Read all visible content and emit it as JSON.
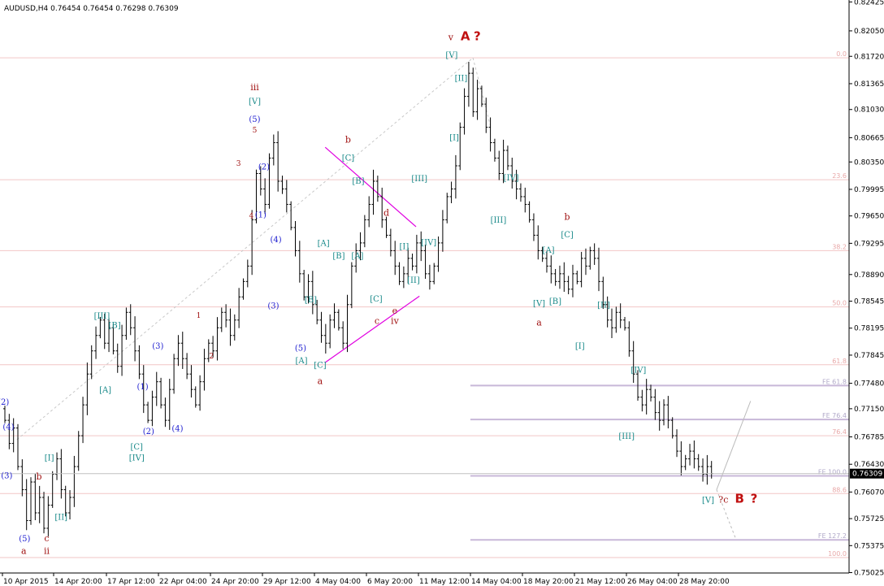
{
  "header": {
    "symbol_line": "AUDUSD,H4  0.76454 0.76454 0.76298 0.76309"
  },
  "colors": {
    "candle": "#000000",
    "fib_line": "#f2c6c6",
    "fe_line": "#c8b8d8",
    "channel": "#e000e0",
    "current_price_bg": "#000000",
    "current_price_text": "#ffffff"
  },
  "chart_data": {
    "type": "bar",
    "symbol": "AUDUSD",
    "timeframe": "H4",
    "ohlc_header": {
      "open": 0.76454,
      "high": 0.76454,
      "low": 0.76298,
      "close": 0.76309
    },
    "current_price": "0.76309",
    "ylim": [
      0.7502,
      0.8245
    ],
    "y_ticks": [
      "0.82425",
      "0.82050",
      "0.81720",
      "0.81365",
      "0.81030",
      "0.80665",
      "0.80350",
      "0.79995",
      "0.79650",
      "0.79295",
      "0.78890",
      "0.78545",
      "0.78195",
      "0.77845",
      "0.77480",
      "0.77150",
      "0.76785",
      "0.76430",
      "0.76070",
      "0.75725",
      "0.75375",
      "0.75025"
    ],
    "x_ticks": [
      "10 Apr 2015",
      "14 Apr 20:00",
      "17 Apr 12:00",
      "22 Apr 04:00",
      "24 Apr 20:00",
      "29 Apr 12:00",
      "4 May 04:00",
      "6 May 20:00",
      "11 May 12:00",
      "14 May 04:00",
      "18 May 20:00",
      "21 May 12:00",
      "26 May 04:00",
      "28 May 20:00"
    ],
    "closes": [
      0.77,
      0.767,
      0.769,
      0.764,
      0.761,
      0.757,
      0.762,
      0.758,
      0.76,
      0.756,
      0.759,
      0.763,
      0.765,
      0.761,
      0.758,
      0.76,
      0.764,
      0.768,
      0.772,
      0.776,
      0.779,
      0.781,
      0.783,
      0.78,
      0.782,
      0.779,
      0.777,
      0.781,
      0.784,
      0.782,
      0.779,
      0.776,
      0.772,
      0.77,
      0.773,
      0.775,
      0.772,
      0.77,
      0.774,
      0.778,
      0.78,
      0.778,
      0.776,
      0.774,
      0.772,
      0.775,
      0.778,
      0.78,
      0.779,
      0.782,
      0.784,
      0.783,
      0.781,
      0.783,
      0.786,
      0.788,
      0.79,
      0.796,
      0.802,
      0.8,
      0.798,
      0.804,
      0.806,
      0.801,
      0.8,
      0.798,
      0.795,
      0.792,
      0.789,
      0.786,
      0.788,
      0.785,
      0.783,
      0.781,
      0.78,
      0.783,
      0.784,
      0.782,
      0.78,
      0.785,
      0.79,
      0.792,
      0.793,
      0.796,
      0.798,
      0.801,
      0.799,
      0.796,
      0.794,
      0.792,
      0.79,
      0.788,
      0.789,
      0.791,
      0.79,
      0.793,
      0.792,
      0.789,
      0.788,
      0.79,
      0.793,
      0.796,
      0.799,
      0.8,
      0.803,
      0.808,
      0.812,
      0.815,
      0.81,
      0.813,
      0.811,
      0.808,
      0.806,
      0.804,
      0.802,
      0.805,
      0.803,
      0.801,
      0.8,
      0.799,
      0.798,
      0.796,
      0.794,
      0.792,
      0.791,
      0.79,
      0.789,
      0.788,
      0.789,
      0.788,
      0.787,
      0.789,
      0.788,
      0.791,
      0.79,
      0.792,
      0.791,
      0.788,
      0.785,
      0.783,
      0.782,
      0.784,
      0.783,
      0.782,
      0.779,
      0.776,
      0.773,
      0.772,
      0.774,
      0.773,
      0.771,
      0.77,
      0.772,
      0.77,
      0.768,
      0.766,
      0.764,
      0.765,
      0.766,
      0.765,
      0.764,
      0.763,
      0.764,
      0.7631
    ],
    "fib_levels": [
      {
        "label": "0.0",
        "price": 0.817
      },
      {
        "label": "23.6",
        "price": 0.8012
      },
      {
        "label": "38.2",
        "price": 0.792
      },
      {
        "label": "50.0",
        "price": 0.7847
      },
      {
        "label": "61.8",
        "price": 0.7772
      },
      {
        "label": "76.4",
        "price": 0.768
      },
      {
        "label": "88.6",
        "price": 0.7605
      },
      {
        "label": "100.0",
        "price": 0.7522
      }
    ],
    "fe_levels": [
      {
        "label": "FE 61.8",
        "price": 0.7745
      },
      {
        "label": "FE 76.4",
        "price": 0.7701
      },
      {
        "label": "FE 100.0",
        "price": 0.7628
      },
      {
        "label": "FE 127.2",
        "price": 0.7545
      }
    ],
    "wave_labels": [
      {
        "text": "(2)",
        "style": "blue",
        "x": 0.004,
        "price": 0.772
      },
      {
        "text": "(4)",
        "style": "blue",
        "x": 0.01,
        "price": 0.7688
      },
      {
        "text": "(3)",
        "style": "blue",
        "x": 0.008,
        "price": 0.7625
      },
      {
        "text": "[I]",
        "style": "teal",
        "x": 0.058,
        "price": 0.7648
      },
      {
        "text": "[II]",
        "style": "teal",
        "x": 0.072,
        "price": 0.7571
      },
      {
        "text": "(5)",
        "style": "blue",
        "x": 0.029,
        "price": 0.7543
      },
      {
        "text": "b",
        "style": "red",
        "x": 0.046,
        "price": 0.7623
      },
      {
        "text": "c",
        "style": "red",
        "x": 0.055,
        "price": 0.7543
      },
      {
        "text": "a",
        "style": "red",
        "x": 0.028,
        "price": 0.7527
      },
      {
        "text": "ii",
        "style": "red",
        "x": 0.055,
        "price": 0.7527
      },
      {
        "text": "[III]",
        "style": "teal",
        "x": 0.12,
        "price": 0.7832
      },
      {
        "text": "[B]",
        "style": "teal",
        "x": 0.135,
        "price": 0.782
      },
      {
        "text": "[A]",
        "style": "teal",
        "x": 0.124,
        "price": 0.7736
      },
      {
        "text": "(3)",
        "style": "blue",
        "x": 0.186,
        "price": 0.7793
      },
      {
        "text": "(1)",
        "style": "blue",
        "x": 0.168,
        "price": 0.774
      },
      {
        "text": "(2)",
        "style": "blue",
        "x": 0.175,
        "price": 0.7682
      },
      {
        "text": "(4)",
        "style": "blue",
        "x": 0.209,
        "price": 0.7686
      },
      {
        "text": "[C]",
        "style": "teal",
        "x": 0.161,
        "price": 0.7662
      },
      {
        "text": "[IV]",
        "style": "teal",
        "x": 0.161,
        "price": 0.7648
      },
      {
        "text": "1",
        "style": "small-red",
        "x": 0.234,
        "price": 0.7833
      },
      {
        "text": "2",
        "style": "small-red",
        "x": 0.249,
        "price": 0.778
      },
      {
        "text": "3",
        "style": "small-red",
        "x": 0.281,
        "price": 0.803
      },
      {
        "text": "4",
        "style": "small-red",
        "x": 0.296,
        "price": 0.7962
      },
      {
        "text": "5",
        "style": "small-red",
        "x": 0.3,
        "price": 0.8073
      },
      {
        "text": "iii",
        "style": "red",
        "x": 0.3,
        "price": 0.8128
      },
      {
        "text": "[V]",
        "style": "teal",
        "x": 0.3,
        "price": 0.811
      },
      {
        "text": "(5)",
        "style": "blue",
        "x": 0.3,
        "price": 0.8087
      },
      {
        "text": "(2)",
        "style": "blue",
        "x": 0.311,
        "price": 0.8025
      },
      {
        "text": "(1)",
        "style": "blue",
        "x": 0.307,
        "price": 0.7963
      },
      {
        "text": "(4)",
        "style": "blue",
        "x": 0.325,
        "price": 0.7931
      },
      {
        "text": "(3)",
        "style": "blue",
        "x": 0.322,
        "price": 0.7845
      },
      {
        "text": "b",
        "style": "red",
        "x": 0.41,
        "price": 0.806
      },
      {
        "text": "[C]",
        "style": "teal",
        "x": 0.41,
        "price": 0.8037
      },
      {
        "text": "[B]",
        "style": "teal",
        "x": 0.422,
        "price": 0.8007
      },
      {
        "text": "[A]",
        "style": "teal",
        "x": 0.381,
        "price": 0.7926
      },
      {
        "text": "[B]",
        "style": "teal",
        "x": 0.399,
        "price": 0.791
      },
      {
        "text": "[A]",
        "style": "teal",
        "x": 0.421,
        "price": 0.791
      },
      {
        "text": "[B]",
        "style": "teal",
        "x": 0.366,
        "price": 0.7853
      },
      {
        "text": "(5)",
        "style": "blue",
        "x": 0.354,
        "price": 0.779
      },
      {
        "text": "[A]",
        "style": "teal",
        "x": 0.355,
        "price": 0.7774
      },
      {
        "text": "[C]",
        "style": "teal",
        "x": 0.377,
        "price": 0.7768
      },
      {
        "text": "a",
        "style": "red",
        "x": 0.377,
        "price": 0.7747
      },
      {
        "text": "d",
        "style": "red",
        "x": 0.455,
        "price": 0.7965
      },
      {
        "text": "[I]",
        "style": "teal",
        "x": 0.476,
        "price": 0.7922
      },
      {
        "text": "[C]",
        "style": "teal",
        "x": 0.443,
        "price": 0.7854
      },
      {
        "text": "c",
        "style": "red",
        "x": 0.444,
        "price": 0.7825
      },
      {
        "text": "e",
        "style": "red",
        "x": 0.465,
        "price": 0.7838
      },
      {
        "text": "iv",
        "style": "red",
        "x": 0.465,
        "price": 0.7825
      },
      {
        "text": "[II]",
        "style": "teal",
        "x": 0.487,
        "price": 0.7878
      },
      {
        "text": "[IV]",
        "style": "teal",
        "x": 0.505,
        "price": 0.7927
      },
      {
        "text": "[III]",
        "style": "teal",
        "x": 0.494,
        "price": 0.801
      },
      {
        "text": "v",
        "style": "red",
        "x": 0.531,
        "price": 0.8193
      },
      {
        "text": "A",
        "style": "red-bold",
        "x": 0.548,
        "price": 0.8193
      },
      {
        "text": "?",
        "style": "red-bold",
        "x": 0.562,
        "price": 0.8193
      },
      {
        "text": "[V]",
        "style": "teal",
        "x": 0.532,
        "price": 0.817
      },
      {
        "text": "[II]",
        "style": "teal",
        "x": 0.543,
        "price": 0.814
      },
      {
        "text": "[I]",
        "style": "teal",
        "x": 0.535,
        "price": 0.8063
      },
      {
        "text": "[IV]",
        "style": "teal",
        "x": 0.602,
        "price": 0.8011
      },
      {
        "text": "[III]",
        "style": "teal",
        "x": 0.587,
        "price": 0.7956
      },
      {
        "text": "b",
        "style": "red",
        "x": 0.668,
        "price": 0.796
      },
      {
        "text": "[C]",
        "style": "teal",
        "x": 0.668,
        "price": 0.7937
      },
      {
        "text": "[A]",
        "style": "teal",
        "x": 0.646,
        "price": 0.7917
      },
      {
        "text": "[V]",
        "style": "teal",
        "x": 0.635,
        "price": 0.7848
      },
      {
        "text": "[B]",
        "style": "teal",
        "x": 0.654,
        "price": 0.7851
      },
      {
        "text": "a",
        "style": "red",
        "x": 0.635,
        "price": 0.7823
      },
      {
        "text": "[II]",
        "style": "teal",
        "x": 0.711,
        "price": 0.7846
      },
      {
        "text": "[I]",
        "style": "teal",
        "x": 0.683,
        "price": 0.7793
      },
      {
        "text": "[IV]",
        "style": "teal",
        "x": 0.752,
        "price": 0.7762
      },
      {
        "text": "[III]",
        "style": "teal",
        "x": 0.738,
        "price": 0.7676
      },
      {
        "text": "[V]",
        "style": "teal",
        "x": 0.834,
        "price": 0.7593
      },
      {
        "text": "?c",
        "style": "red",
        "x": 0.852,
        "price": 0.7593
      },
      {
        "text": "B",
        "style": "red-bold",
        "x": 0.871,
        "price": 0.7593
      },
      {
        "text": "?",
        "style": "red-bold",
        "x": 0.888,
        "price": 0.7593
      }
    ]
  }
}
